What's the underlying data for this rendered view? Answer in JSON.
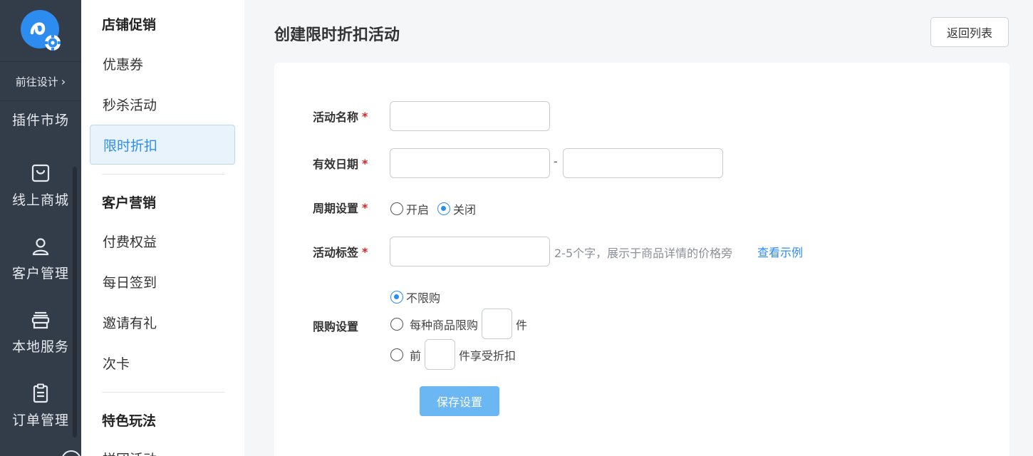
{
  "nav": {
    "goto_design": "前往设计",
    "items": [
      {
        "label": "插件市场",
        "icon": "plugin-icon"
      },
      {
        "label": "线上商城",
        "icon": "shopping-bag-icon"
      },
      {
        "label": "客户管理",
        "icon": "user-icon"
      },
      {
        "label": "本地服务",
        "icon": "store-icon"
      },
      {
        "label": "订单管理",
        "icon": "clipboard-icon"
      }
    ]
  },
  "submenu": {
    "groups": [
      {
        "title": "店铺促销",
        "items": [
          "优惠券",
          "秒杀活动",
          "限时折扣"
        ],
        "active": "限时折扣"
      },
      {
        "title": "客户营销",
        "items": [
          "付费权益",
          "每日签到",
          "邀请有礼",
          "次卡"
        ]
      },
      {
        "title": "特色玩法",
        "items": [
          "拼团活动"
        ]
      }
    ]
  },
  "page": {
    "title": "创建限时折扣活动",
    "back_button": "返回列表"
  },
  "form": {
    "activity_name": {
      "label": "活动名称",
      "value": ""
    },
    "valid_date": {
      "label": "有效日期",
      "start": "",
      "end": "",
      "separator": "-"
    },
    "cycle": {
      "label": "周期设置",
      "options": [
        "开启",
        "关闭"
      ],
      "selected": "关闭"
    },
    "tag": {
      "label": "活动标签",
      "value": "",
      "hint": "2-5个字，展示于商品详情的价格旁",
      "example_link": "查看示例"
    },
    "limit": {
      "label": "限购设置",
      "option_none": "不限购",
      "option_per_product_prefix": "每种商品限购",
      "option_per_product_suffix": "件",
      "option_first_prefix": "前",
      "option_first_suffix": "件享受折扣",
      "selected": "不限购"
    },
    "save_button": "保存设置"
  },
  "colors": {
    "nav_bg": "#333d4a",
    "accent": "#2d8cf0",
    "save_button": "#6ab7f3",
    "required": "#e02020"
  }
}
